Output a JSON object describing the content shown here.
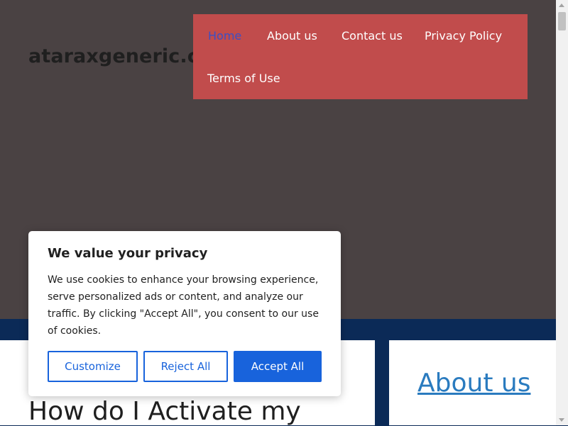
{
  "site": {
    "title": "ataraxgeneric.com"
  },
  "nav": {
    "items": [
      {
        "label": "Home",
        "active": true
      },
      {
        "label": "About us"
      },
      {
        "label": "Contact us"
      },
      {
        "label": "Privacy Policy"
      },
      {
        "label": "Terms of Use"
      }
    ]
  },
  "main": {
    "post_title_partial": "How do I Activate my"
  },
  "sidebar": {
    "heading": "About us"
  },
  "cookie_banner": {
    "title": "We value your privacy",
    "body": "We use cookies to enhance your browsing experience, serve personalized ads or content, and analyze our traffic. By clicking \"Accept All\", you consent to our use of cookies.",
    "buttons": {
      "customize": "Customize",
      "reject": "Reject All",
      "accept": "Accept All"
    }
  },
  "colors": {
    "header_bg": "#4a4243",
    "nav_bg": "#c14c4c",
    "band_bg": "#0b2a57",
    "accent": "#1863dc",
    "link": "#2a7bbf"
  }
}
